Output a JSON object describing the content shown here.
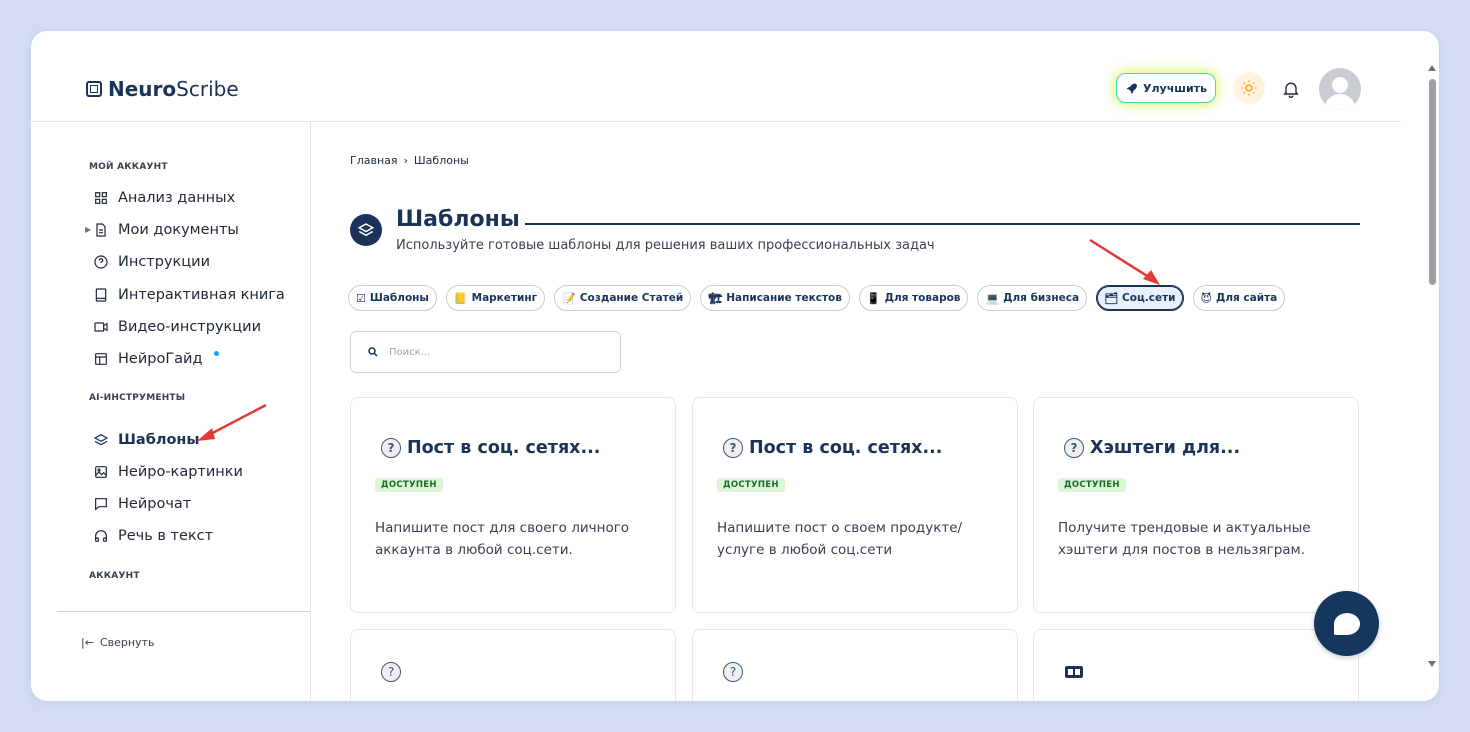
{
  "app": {
    "logo_bold": "Neuro",
    "logo_regular": "Scribe",
    "upgrade_label": "Улучшить"
  },
  "sidebar": {
    "section_account_my": "МОЙ АККАУНТ",
    "items_account": [
      {
        "label": "Анализ данных",
        "icon": "grid-icon"
      },
      {
        "label": "Мои документы",
        "icon": "document-icon"
      },
      {
        "label": "Инструкции",
        "icon": "help-circle-icon"
      },
      {
        "label": "Интерактивная книга",
        "icon": "book-icon"
      },
      {
        "label": "Видео-инструкции",
        "icon": "video-icon"
      },
      {
        "label": "НейроГайд",
        "icon": "layout-icon"
      }
    ],
    "section_ai": "AI-ИНСТРУМЕНТЫ",
    "items_ai": [
      {
        "label": "Шаблоны",
        "icon": "layers-icon",
        "active": true
      },
      {
        "label": "Нейро-картинки",
        "icon": "image-icon"
      },
      {
        "label": "Нейрочат",
        "icon": "chat-icon"
      },
      {
        "label": "Речь в текст",
        "icon": "headphones-icon"
      }
    ],
    "section_account": "АККАУНТ",
    "collapse_label": "Свернуть",
    "collapse_icon": "|←"
  },
  "breadcrumb": {
    "home": "Главная",
    "separator": "›",
    "current": "Шаблоны"
  },
  "page": {
    "title": "Шаблоны",
    "subtitle": "Используйте готовые шаблоны для решения ваших профессиональных задач"
  },
  "categories": [
    {
      "emoji": "☑",
      "label": "Шаблоны"
    },
    {
      "emoji": "📒",
      "label": "Маркетинг"
    },
    {
      "emoji": "📝",
      "label": "Создание Статей"
    },
    {
      "emoji": "🏗",
      "label": "Написание текстов"
    },
    {
      "emoji": "📱",
      "label": "Для товаров"
    },
    {
      "emoji": "💻",
      "label": "Для бизнеса"
    },
    {
      "emoji": "🗂",
      "label": "Соц.сети",
      "active": true
    },
    {
      "emoji": "😈",
      "label": "Для сайта"
    }
  ],
  "search": {
    "placeholder": "Поиск..."
  },
  "cards": [
    {
      "title": "Пост в соц. сетях...",
      "badge": "ДОСТУПЕН",
      "description": "Напишите пост для своего личного аккаунта в любой соц.сети.",
      "icon": "question-icon"
    },
    {
      "title": "Пост в соц. сетях...",
      "badge": "ДОСТУПЕН",
      "description": "Напишите пост о своем продукте/ услуге в любой соц.сети",
      "icon": "question-icon"
    },
    {
      "title": "Хэштеги для...",
      "badge": "ДОСТУПЕН",
      "description": "Получите трендовые и актуальные хэштеги для постов в нельзяграм.",
      "icon": "question-icon"
    }
  ],
  "colors": {
    "primary": "#1b3358",
    "badge_bg": "#dcf5d6",
    "arrow": "#e53935"
  }
}
